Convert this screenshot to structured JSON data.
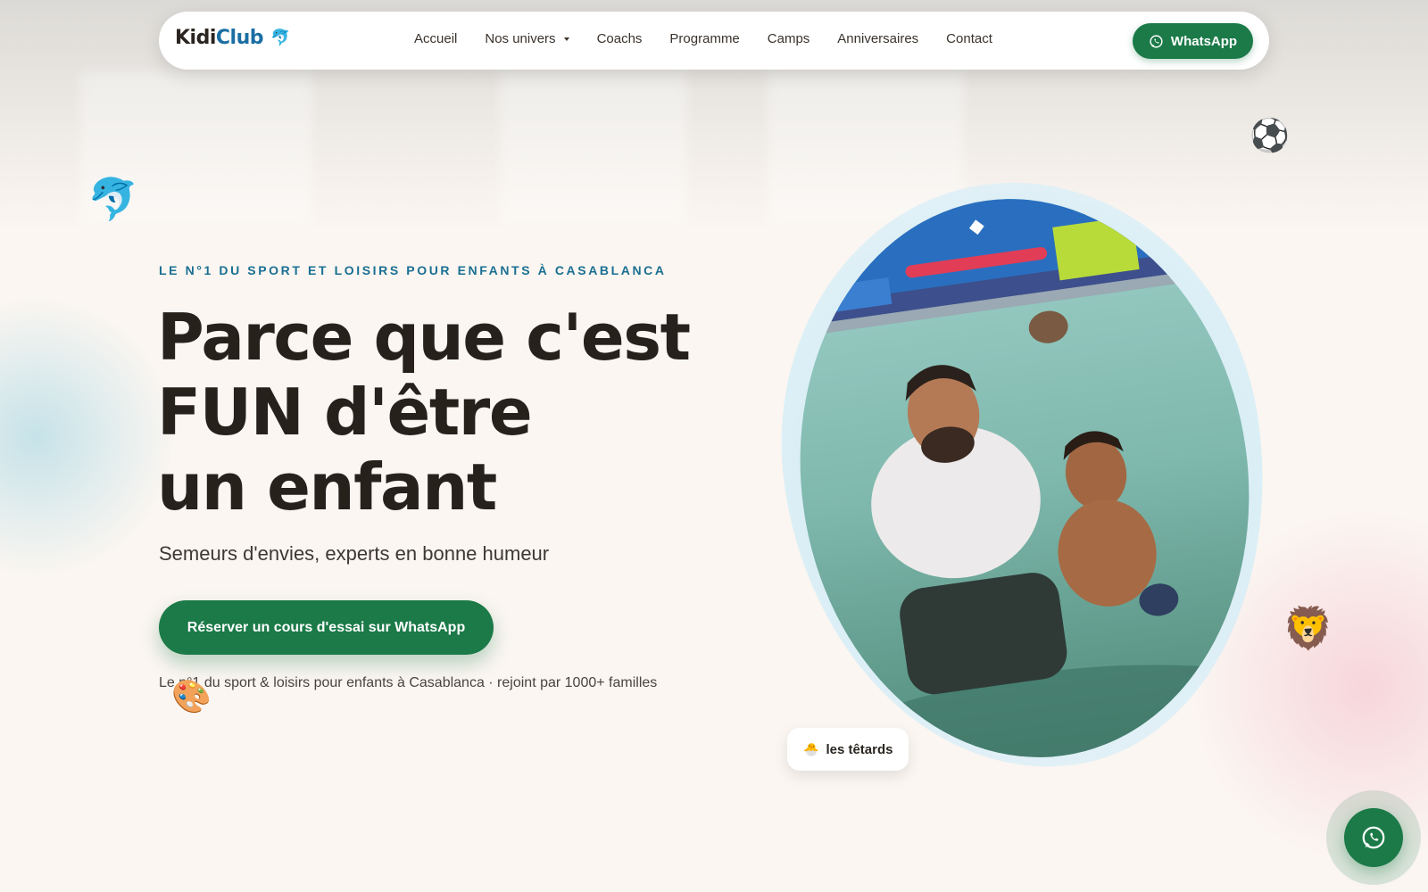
{
  "brand": {
    "name_part1": "Kidi",
    "name_part2": "Club",
    "mascot_icon": "🐬"
  },
  "nav": {
    "items": [
      {
        "label": "Accueil"
      },
      {
        "label": "Nos univers",
        "has_dropdown": true
      },
      {
        "label": "Coachs"
      },
      {
        "label": "Programme"
      },
      {
        "label": "Camps"
      },
      {
        "label": "Anniversaires"
      },
      {
        "label": "Contact"
      }
    ],
    "whatsapp_label": "WhatsApp"
  },
  "hero": {
    "eyebrow": "LE N°1 DU SPORT ET LOISIRS POUR ENFANTS À CASABLANCA",
    "headline": [
      "Parce que c'est",
      "FUN d'être",
      "un enfant"
    ],
    "subtitle": "Semeurs d'envies, experts en bonne humeur",
    "cta_label": "Réserver un cours d'essai sur WhatsApp",
    "trust_line": "Le n°1 du sport & loisirs pour enfants à Casablanca · rejoint par 1000+ familles",
    "image_badge": {
      "icon": "🐣",
      "label": "les têtards"
    }
  },
  "floating_icons": {
    "dolphin": "🐬",
    "soccer_ball": "⚽",
    "lion": "🦁",
    "palette": "🎨"
  },
  "colors": {
    "accent_green": "#1b7a48",
    "brand_blue": "#1a6ea3",
    "eyebrow_blue": "#1a6f93",
    "text_dark": "#27211c",
    "background": "#fbf6f1"
  }
}
